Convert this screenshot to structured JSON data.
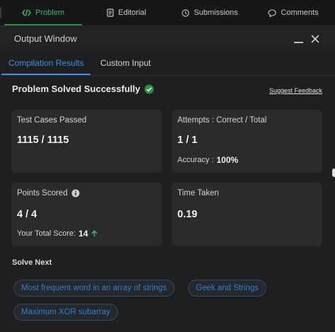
{
  "top_tabs": [
    {
      "label": "Problem",
      "active": true,
      "icon": "code-icon"
    },
    {
      "label": "Editorial",
      "active": false,
      "icon": "document-icon"
    },
    {
      "label": "Submissions",
      "active": false,
      "icon": "clock-icon"
    },
    {
      "label": "Comments",
      "active": false,
      "icon": "comment-icon"
    }
  ],
  "output_window": {
    "title": "Output Window",
    "sub_tabs": [
      {
        "label": "Compilation Results",
        "active": true
      },
      {
        "label": "Custom Input",
        "active": false
      }
    ]
  },
  "result": {
    "status": "Problem Solved Successfully",
    "suggest_feedback": "Suggest Feedback"
  },
  "cards": {
    "test_cases": {
      "label": "Test Cases Passed",
      "value": "1115 / 1115"
    },
    "attempts": {
      "label": "Attempts : Correct / Total",
      "value": "1 / 1",
      "accuracy_label": "Accuracy :",
      "accuracy_value": "100%"
    },
    "points": {
      "label": "Points Scored",
      "value": "4 / 4",
      "total_label": "Your Total Score:",
      "total_value": "14"
    },
    "time": {
      "label": "Time Taken",
      "value": "0.19"
    }
  },
  "solve_next": {
    "title": "Solve Next",
    "items": [
      "Most frequent word in an array of strings",
      "Geek and Strings",
      "Maximum XOR subarray"
    ]
  },
  "colors": {
    "accent_green": "#2f8d46",
    "accent_blue": "#3d8fe0",
    "card_bg": "#2a2b2d"
  }
}
